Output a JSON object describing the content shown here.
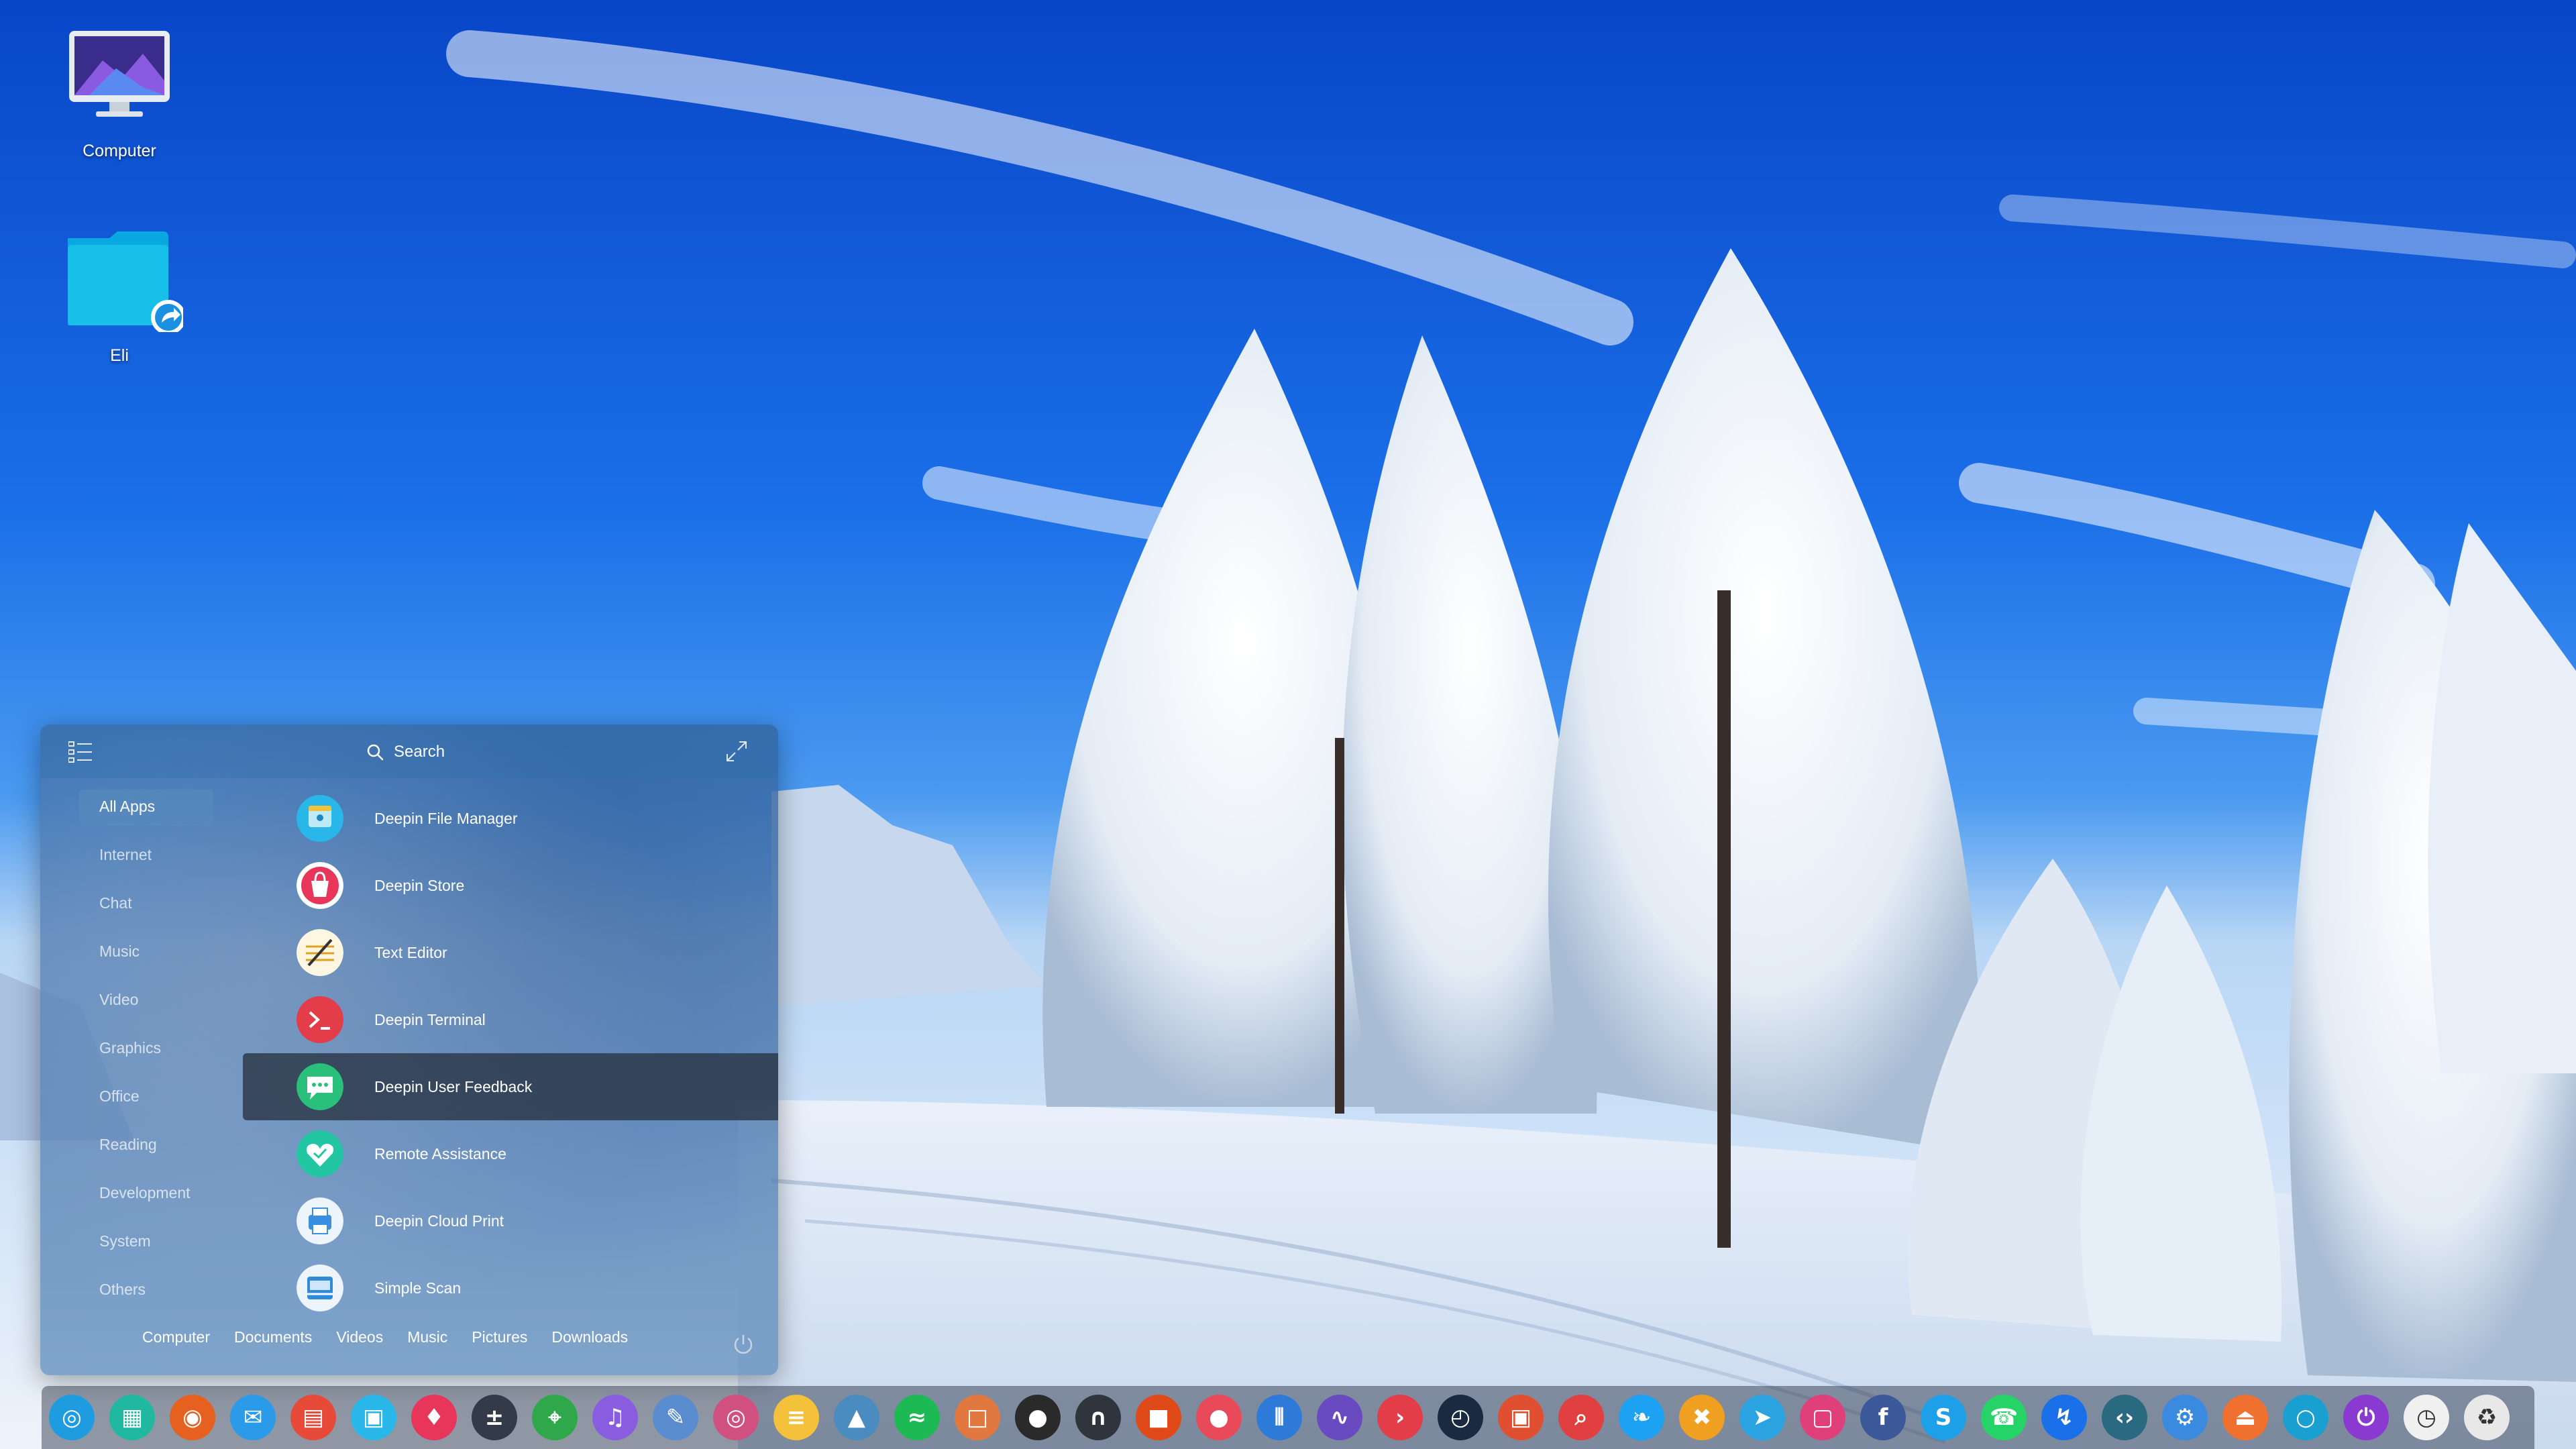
{
  "desktop": {
    "icons": [
      {
        "label": "Computer",
        "icon": "computer-icon"
      },
      {
        "label": "Eli",
        "icon": "folder-link-icon"
      }
    ]
  },
  "launcher": {
    "search_label": "Search",
    "categories": [
      {
        "label": "All Apps",
        "active": true
      },
      {
        "label": "Internet"
      },
      {
        "label": "Chat"
      },
      {
        "label": "Music"
      },
      {
        "label": "Video"
      },
      {
        "label": "Graphics"
      },
      {
        "label": "Office"
      },
      {
        "label": "Reading"
      },
      {
        "label": "Development"
      },
      {
        "label": "System"
      },
      {
        "label": "Others"
      }
    ],
    "apps": [
      {
        "name": "Deepin File Manager",
        "icon": "file-manager-icon",
        "color": "#29b6e8"
      },
      {
        "name": "Deepin Store",
        "icon": "store-icon",
        "color": "#e8355a"
      },
      {
        "name": "Text Editor",
        "icon": "text-editor-icon",
        "color": "#f3c13a"
      },
      {
        "name": "Deepin Terminal",
        "icon": "terminal-icon",
        "color": "#e23d48"
      },
      {
        "name": "Deepin User Feedback",
        "icon": "feedback-icon",
        "color": "#28c07a",
        "selected": true
      },
      {
        "name": "Remote Assistance",
        "icon": "remote-assistance-icon",
        "color": "#22c6a3"
      },
      {
        "name": "Deepin Cloud Print",
        "icon": "cloud-print-icon",
        "color": "#3a8fe0"
      },
      {
        "name": "Simple Scan",
        "icon": "scanner-icon",
        "color": "#2f8ad8"
      }
    ],
    "bottom_links": [
      "Computer",
      "Documents",
      "Videos",
      "Music",
      "Pictures",
      "Downloads"
    ]
  },
  "dock": {
    "items": [
      {
        "icon": "deepin-launcher-icon",
        "color": "#1f9be0"
      },
      {
        "icon": "multitasking-icon",
        "color": "#20b8a0"
      },
      {
        "icon": "firefox-icon",
        "color": "#e66020"
      },
      {
        "icon": "mail-icon",
        "color": "#2b9ae8"
      },
      {
        "icon": "workspace-icon",
        "color": "#e84a3a"
      },
      {
        "icon": "file-manager-icon",
        "color": "#29b6e8"
      },
      {
        "icon": "store-icon",
        "color": "#e8355a"
      },
      {
        "icon": "calculator-icon",
        "color": "#333a48"
      },
      {
        "icon": "maps-icon",
        "color": "#2ea84a"
      },
      {
        "icon": "music-icon",
        "color": "#8a5ce0"
      },
      {
        "icon": "draw-icon",
        "color": "#5a8cd0"
      },
      {
        "icon": "screenshot-icon",
        "color": "#d05080"
      },
      {
        "icon": "text-editor-icon",
        "color": "#f3c13a"
      },
      {
        "icon": "arch-icon",
        "color": "#4a8bc0"
      },
      {
        "icon": "spotify-icon",
        "color": "#1db954"
      },
      {
        "icon": "photos-icon",
        "color": "#e07840"
      },
      {
        "icon": "disc-icon",
        "color": "#2a2a2a"
      },
      {
        "icon": "headphones-icon",
        "color": "#30343c"
      },
      {
        "icon": "office-icon",
        "color": "#e04a18"
      },
      {
        "icon": "recorder-icon",
        "color": "#e84a5a"
      },
      {
        "icon": "mixer-icon",
        "color": "#2d7ad8"
      },
      {
        "icon": "sound-wave-icon",
        "color": "#6a4ac0"
      },
      {
        "icon": "terminal-icon",
        "color": "#e23d48"
      },
      {
        "icon": "system-monitor-icon",
        "color": "#1a2a40"
      },
      {
        "icon": "presentation-icon",
        "color": "#e05030"
      },
      {
        "icon": "search-tool-icon",
        "color": "#e04040"
      },
      {
        "icon": "twitter-icon",
        "color": "#1da1f2"
      },
      {
        "icon": "xbox-icon",
        "color": "#f0a020"
      },
      {
        "icon": "telegram-icon",
        "color": "#2aa3e0"
      },
      {
        "icon": "instagram-icon",
        "color": "#e0407a"
      },
      {
        "icon": "facebook-icon",
        "color": "#3b5998"
      },
      {
        "icon": "skype-icon",
        "color": "#1da0e8"
      },
      {
        "icon": "whatsapp-icon",
        "color": "#25d366"
      },
      {
        "icon": "messenger-icon",
        "color": "#1a70e8"
      },
      {
        "icon": "vscode-icon",
        "color": "#2a6a80"
      },
      {
        "icon": "settings-icon",
        "color": "#3a8ae0"
      },
      {
        "icon": "eject-icon",
        "color": "#f07030"
      },
      {
        "icon": "cd-icon",
        "color": "#1aa0d0"
      },
      {
        "icon": "power-icon",
        "color": "#8a3ad0"
      },
      {
        "icon": "clock-icon",
        "color": "#f0f0f0"
      },
      {
        "icon": "trash-icon",
        "color": "#e8e8e8"
      }
    ]
  }
}
